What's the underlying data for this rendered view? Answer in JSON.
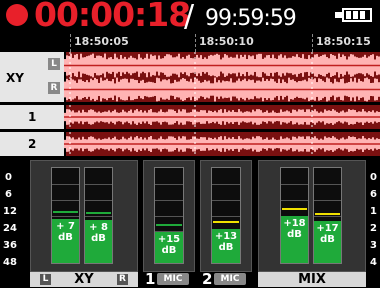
{
  "header": {
    "elapsed": "00:00:18",
    "separator": "/",
    "remaining": "99:59:59",
    "record_color": "#e8202a"
  },
  "timeline": {
    "ticks": [
      "18:50:05",
      "18:50:10",
      "18:50:15"
    ]
  },
  "tracks": [
    {
      "name": "XY",
      "left_badge": "L",
      "right_badge": "R"
    },
    {
      "name": "1"
    },
    {
      "name": "2"
    }
  ],
  "scale": [
    "0",
    "6",
    "12",
    "24",
    "36",
    "48"
  ],
  "scale_right": [
    "0",
    "6",
    "1",
    "2",
    "3",
    "4"
  ],
  "meters": {
    "xy": {
      "label": "XY",
      "left_badge": "L",
      "right_badge": "R",
      "left": {
        "gain_value": "+ 7",
        "gain_unit": "dB",
        "level": 0.46
      },
      "right": {
        "gain_value": "+ 8",
        "gain_unit": "dB",
        "level": 0.45
      }
    },
    "ch1": {
      "number": "1",
      "badge": "MIC",
      "gain_value": "+15",
      "gain_unit": "dB",
      "level": 0.33
    },
    "ch2": {
      "number": "2",
      "badge": "MIC",
      "gain_value": "+13",
      "gain_unit": "dB",
      "level": 0.36
    },
    "mix": {
      "label": "MIX",
      "left": {
        "gain_value": "+18",
        "gain_unit": "dB",
        "level": 0.49
      },
      "right": {
        "gain_value": "+17",
        "gain_unit": "dB",
        "level": 0.44
      }
    }
  },
  "colors": {
    "meter_fill": "#1faa3a",
    "peak_green": "#1faa3a",
    "peak_yellow": "#f0e000",
    "waveform_bg": "#7a1010",
    "waveform": "#ffb3b3"
  }
}
